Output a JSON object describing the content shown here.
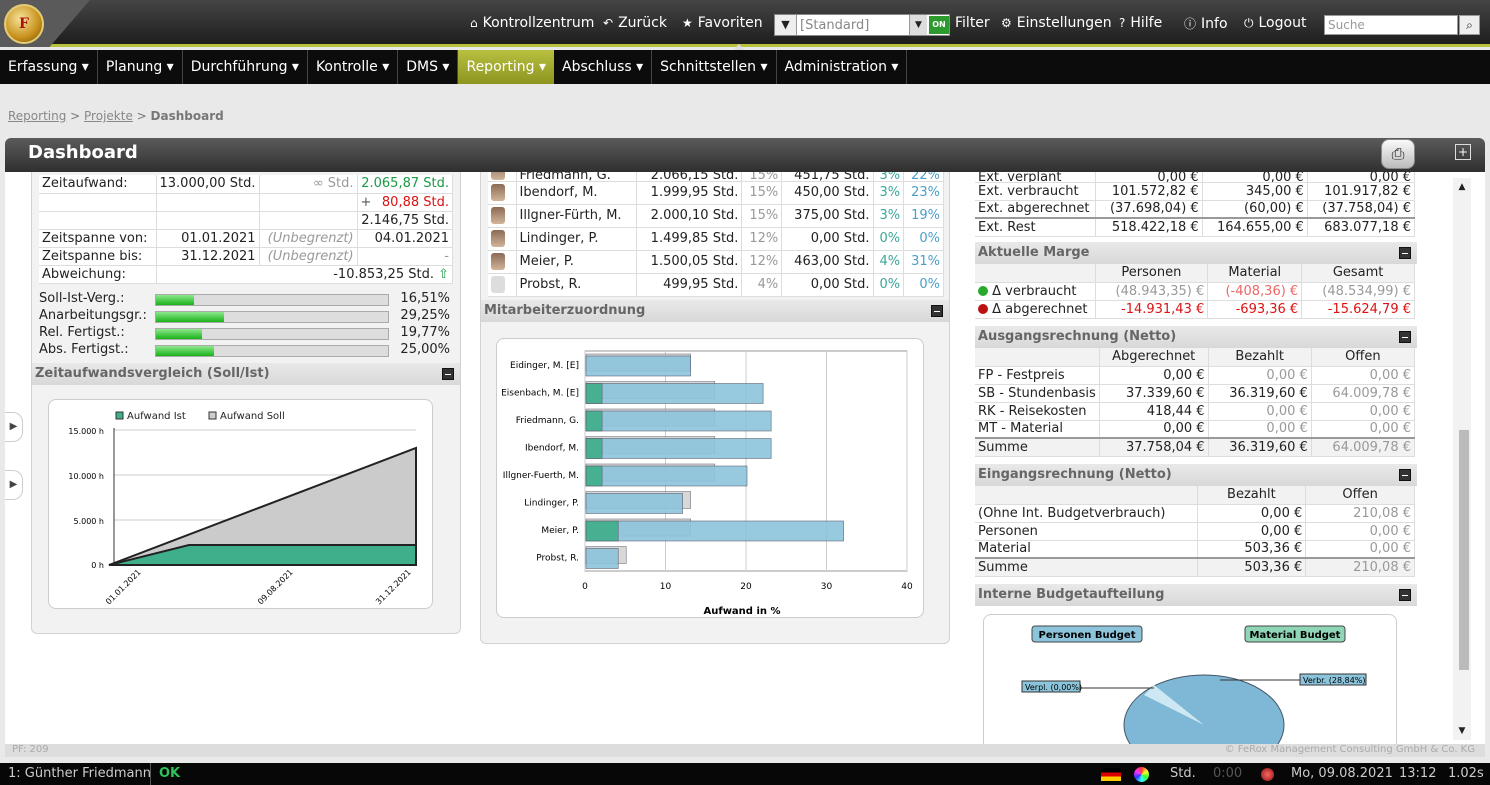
{
  "header": {
    "logo_text": "F",
    "links": {
      "home": "Kontrollzentrum",
      "back": "Zurück",
      "favorites": "Favoriten",
      "filter": "Filter",
      "settings": "Einstellungen",
      "help": "Hilfe",
      "info": "Info",
      "logout": "Logout"
    },
    "filter_value": "[Standard]",
    "filter_on": "ON",
    "search_placeholder": "Suche"
  },
  "menu": [
    "Erfassung ▾",
    "Planung ▾",
    "Durchführung ▾",
    "Kontrolle ▾",
    "DMS ▾",
    "Reporting ▾",
    "Abschluss ▾",
    "Schnittstellen ▾",
    "Administration ▾"
  ],
  "menu_active": "Reporting ▾",
  "breadcrumb": {
    "l1": "Reporting",
    "l2": "Projekte",
    "current": "Dashboard"
  },
  "page_title": "Dashboard",
  "time": {
    "zeitaufwand_label": "Zeitaufwand:",
    "zeitaufwand": "13.000,00 Std.",
    "zeitaufwand_inf": "∞ Std.",
    "ist": "2.065,87 Std.",
    "plus": "+",
    "extra": "80,88 Std.",
    "total": "2.146,75 Std.",
    "von_label": "Zeitspanne von:",
    "von": "01.01.2021",
    "von_unb": "(Unbegrenzt)",
    "von_ist": "04.01.2021",
    "bis_label": "Zeitspanne bis:",
    "bis": "31.12.2021",
    "bis_unb": "(Unbegrenzt)",
    "bis_ist": "-",
    "abw_label": "Abweichung:",
    "abw": "-10.853,25 Std."
  },
  "progress": [
    {
      "label": "Soll-Ist-Verg.:",
      "value": "16,51%",
      "fraction": 0.1651
    },
    {
      "label": "Anarbeitungsgr.:",
      "value": "29,25%",
      "fraction": 0.2925
    },
    {
      "label": "Rel. Fertigst.:",
      "value": "19,77%",
      "fraction": 0.1977
    },
    {
      "label": "Abs. Fertigst.:",
      "value": "25,00%",
      "fraction": 0.25
    }
  ],
  "zeit_chart": {
    "title": "Zeitaufwandsvergleich (Soll/Ist)",
    "legend_ist": "Aufwand Ist",
    "legend_soll": "Aufwand Soll",
    "yticks": [
      "15.000 h",
      "10.000 h",
      "5.000 h",
      "0 h"
    ],
    "xticks": [
      "01.01.2021",
      "09.08.2021",
      "31.12.2021"
    ]
  },
  "employees": [
    {
      "name": "Friedmann, G.",
      "std": "2.066,15 Std.",
      "pct": "15%",
      "cost": "451,75 Std.",
      "p1": "3%",
      "p2": "22%"
    },
    {
      "name": "Ibendorf, M.",
      "std": "1.999,95 Std.",
      "pct": "15%",
      "cost": "450,00 Std.",
      "p1": "3%",
      "p2": "23%"
    },
    {
      "name": "Illgner-Fürth, M.",
      "std": "2.000,10 Std.",
      "pct": "15%",
      "cost": "375,00 Std.",
      "p1": "3%",
      "p2": "19%"
    },
    {
      "name": "Lindinger, P.",
      "std": "1.499,85 Std.",
      "pct": "12%",
      "cost": "0,00 Std.",
      "p1": "0%",
      "p2": "0%"
    },
    {
      "name": "Meier, P.",
      "std": "1.500,05 Std.",
      "pct": "12%",
      "cost": "463,00 Std.",
      "p1": "4%",
      "p2": "31%"
    },
    {
      "name": "Probst, R.",
      "std": "499,95 Std.",
      "pct": "4%",
      "cost": "0,00 Std.",
      "p1": "0%",
      "p2": "0%"
    }
  ],
  "mitarbeiter": {
    "title": "Mitarbeiterzuordnung",
    "xlabel": "Aufwand in %"
  },
  "chart_data": {
    "type": "bar",
    "categories": [
      "Eidinger, M. [E]",
      "Eisenbach, M. [E]",
      "Friedmann, G.",
      "Ibendorf, M.",
      "Illgner-Fuerth, M.",
      "Lindinger, P.",
      "Meier, P.",
      "Probst, R."
    ],
    "series": [
      {
        "values": [
          0,
          2,
          2,
          2,
          2,
          0,
          4,
          0
        ]
      },
      {
        "values": [
          13,
          22,
          23,
          23,
          20,
          12,
          32,
          4
        ]
      },
      {
        "values": [
          13,
          16,
          16,
          16,
          16,
          13,
          13,
          5
        ]
      }
    ],
    "xlabel": "Aufwand in %",
    "xticks": [
      "0",
      "10",
      "20",
      "30",
      "40"
    ],
    "xlim": [
      0,
      40
    ],
    "colors": [
      "#3fae8a",
      "#8cc4dc",
      "#cfcfcf"
    ]
  },
  "costs": {
    "rows": [
      {
        "label": "Ext. verplant",
        "a": "0,00 €",
        "b": "0,00 €",
        "c": "0,00 €"
      },
      {
        "label": "Ext. verbraucht",
        "a": "101.572,82 €",
        "b": "345,00 €",
        "c": "101.917,82 €"
      },
      {
        "label": "Ext. abgerechnet",
        "a": "(37.698,04) €",
        "b": "(60,00) €",
        "c": "(37.758,04) €"
      },
      {
        "label": "Ext. Rest",
        "a": "518.422,18 €",
        "b": "164.655,00 €",
        "c": "683.077,18 €"
      }
    ]
  },
  "marge": {
    "title": "Aktuelle Marge",
    "headers": [
      "Personen",
      "Material",
      "Gesamt"
    ],
    "rows": [
      {
        "label": "Δ verbraucht",
        "a": "(48.943,35) €",
        "b": "(-408,36) €",
        "c": "(48.534,99) €"
      },
      {
        "label": "Δ abgerechnet",
        "a": "-14.931,43 €",
        "b": "-693,36 €",
        "c": "-15.624,79 €"
      }
    ]
  },
  "ausgang": {
    "title": "Ausgangsrechnung (Netto)",
    "headers": [
      "Abgerechnet",
      "Bezahlt",
      "Offen"
    ],
    "rows": [
      {
        "label": "FP - Festpreis",
        "a": "0,00 €",
        "b": "0,00 €",
        "c": "0,00 €"
      },
      {
        "label": "SB - Stundenbasis",
        "a": "37.339,60 €",
        "b": "36.319,60 €",
        "c": "64.009,78 €"
      },
      {
        "label": "RK - Reisekosten",
        "a": "418,44 €",
        "b": "0,00 €",
        "c": "0,00 €"
      },
      {
        "label": "MT - Material",
        "a": "0,00 €",
        "b": "0,00 €",
        "c": "0,00 €"
      }
    ],
    "sum": {
      "label": "Summe",
      "a": "37.758,04 €",
      "b": "36.319,60 €",
      "c": "64.009,78 €"
    }
  },
  "eingang": {
    "title": "Eingangsrechnung (Netto)",
    "headers": [
      "Bezahlt",
      "Offen"
    ],
    "rows": [
      {
        "label": "(Ohne Int. Budgetverbrauch)",
        "a": "0,00 €",
        "b": "210,08 €"
      },
      {
        "label": "Personen",
        "a": "0,00 €",
        "b": "0,00 €"
      },
      {
        "label": "Material",
        "a": "503,36 €",
        "b": "0,00 €"
      }
    ],
    "sum": {
      "label": "Summe",
      "a": "503,36 €",
      "b": "210,08 €"
    }
  },
  "budget": {
    "title": "Interne Budgetaufteilung",
    "personen": "Personen Budget",
    "material": "Material Budget",
    "verpl": "Verpl. (0,00%)",
    "verbr": "Verbr. (28,84%)"
  },
  "footer": {
    "pf": "PF: 209",
    "copyright": "© FeRox Management Consulting GmbH & Co. KG"
  },
  "status": {
    "user": "1: Günther Friedmann",
    "ok": "OK",
    "unit": "Std.",
    "timer": "0:00",
    "datetime": "Mo, 09.08.2021",
    "clock": "13:12",
    "load": "1.02s"
  }
}
